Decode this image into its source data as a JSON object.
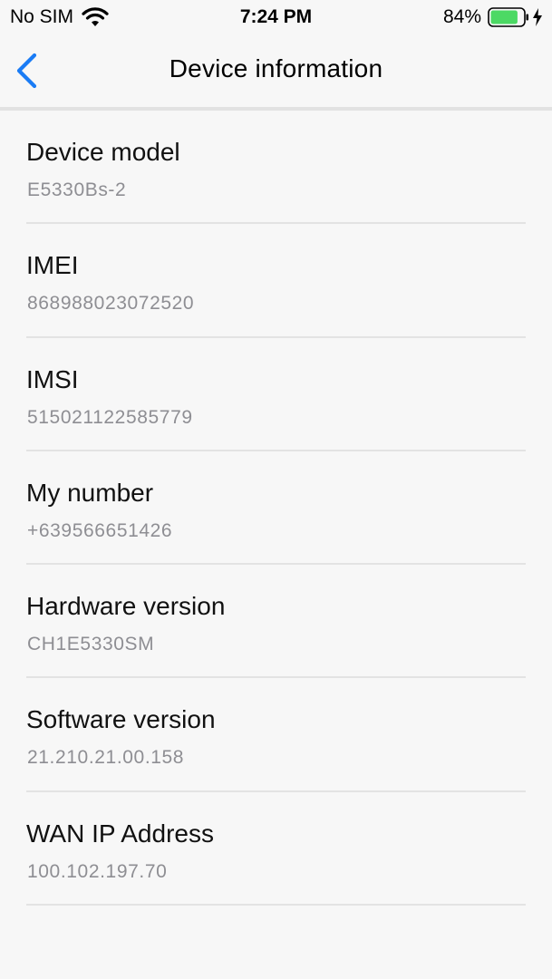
{
  "status_bar": {
    "carrier": "No SIM",
    "time": "7:24 PM",
    "battery_percent": "84%",
    "battery_level": 0.84,
    "battery_color": "#4cd964"
  },
  "nav": {
    "title": "Device information",
    "back_icon": "chevron-left-icon",
    "accent_color": "#1a7cf5"
  },
  "items": [
    {
      "label": "Device model",
      "value": "E5330Bs-2"
    },
    {
      "label": "IMEI",
      "value": "868988023072520"
    },
    {
      "label": "IMSI",
      "value": "515021122585779"
    },
    {
      "label": "My number",
      "value": "+639566651426"
    },
    {
      "label": "Hardware version",
      "value": "CH1E5330SM"
    },
    {
      "label": "Software version",
      "value": "21.210.21.00.158"
    },
    {
      "label": "WAN IP Address",
      "value": "100.102.197.70"
    }
  ]
}
